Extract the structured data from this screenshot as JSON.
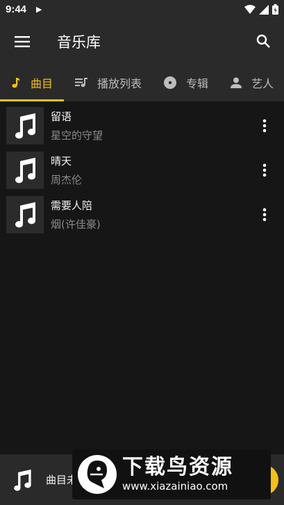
{
  "status": {
    "time": "9:44"
  },
  "toolbar": {
    "title": "音乐库"
  },
  "tabs": [
    {
      "label": "曲目",
      "icon": "music-note-icon",
      "active": true
    },
    {
      "label": "播放列表",
      "icon": "playlist-icon",
      "active": false
    },
    {
      "label": "专辑",
      "icon": "album-icon",
      "active": false
    },
    {
      "label": "艺人",
      "icon": "person-icon",
      "active": false
    }
  ],
  "songs": [
    {
      "title": "留语",
      "artist": "星空的守望"
    },
    {
      "title": "晴天",
      "artist": "周杰伦"
    },
    {
      "title": "需要人陪",
      "artist": "烟(许佳豪)"
    }
  ],
  "mini_player": {
    "text": "曲目未"
  },
  "watermark": {
    "title": "下载鸟资源",
    "url": "www.xiazainiao.com"
  },
  "colors": {
    "accent": "#f5c211",
    "background": "#161616",
    "bar": "#2a2a2a"
  }
}
